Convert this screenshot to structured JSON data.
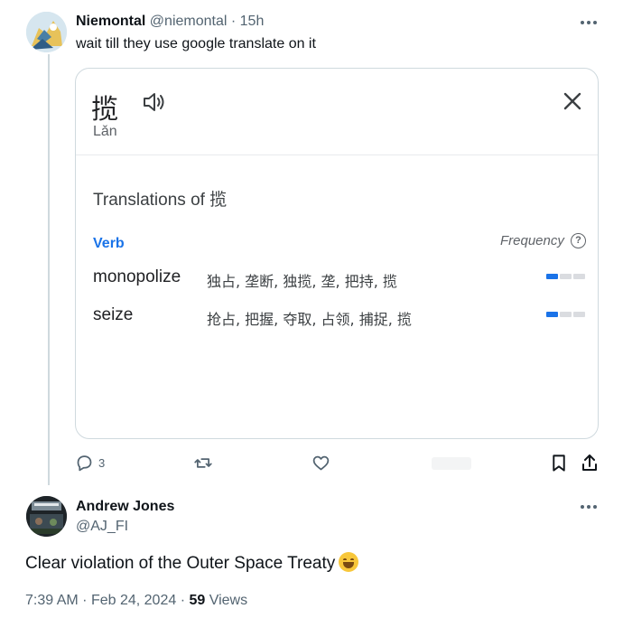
{
  "tweet1": {
    "display_name": "Niemontal",
    "handle": "@niemontal",
    "separator": "·",
    "time": "15h",
    "text": "wait till they use google translate on it",
    "reply_count": "3"
  },
  "translate_card": {
    "headword": "揽",
    "pinyin": "Lǎn",
    "translations_title": "Translations of 揽",
    "part_of_speech": "Verb",
    "frequency_label": "Frequency",
    "help_glyph": "?",
    "rows": [
      {
        "word": "monopolize",
        "synonyms": "独占, 垄断, 独揽, 垄, 把持, 揽",
        "frequency_level": 1,
        "frequency_max": 3
      },
      {
        "word": "seize",
        "synonyms": "抢占, 把握, 夺取, 占领, 捕捉, 揽",
        "frequency_level": 1,
        "frequency_max": 3
      }
    ]
  },
  "tweet2": {
    "display_name": "Andrew Jones",
    "handle": "@AJ_FI",
    "text": "Clear violation of the Outer Space Treaty",
    "emoji": "grinning-face-icon",
    "time": "7:39 AM",
    "date": "Feb 24, 2024",
    "views_count": "59",
    "views_label": "Views",
    "separator": "·"
  },
  "colors": {
    "accent_blue": "#1a73e8",
    "muted_text": "#536471",
    "border": "#cfd9de"
  },
  "icons": [
    "speaker-icon",
    "close-icon",
    "help-icon",
    "reply-icon",
    "retweet-icon",
    "like-icon",
    "views-icon",
    "bookmark-icon",
    "share-icon",
    "more-icon"
  ]
}
